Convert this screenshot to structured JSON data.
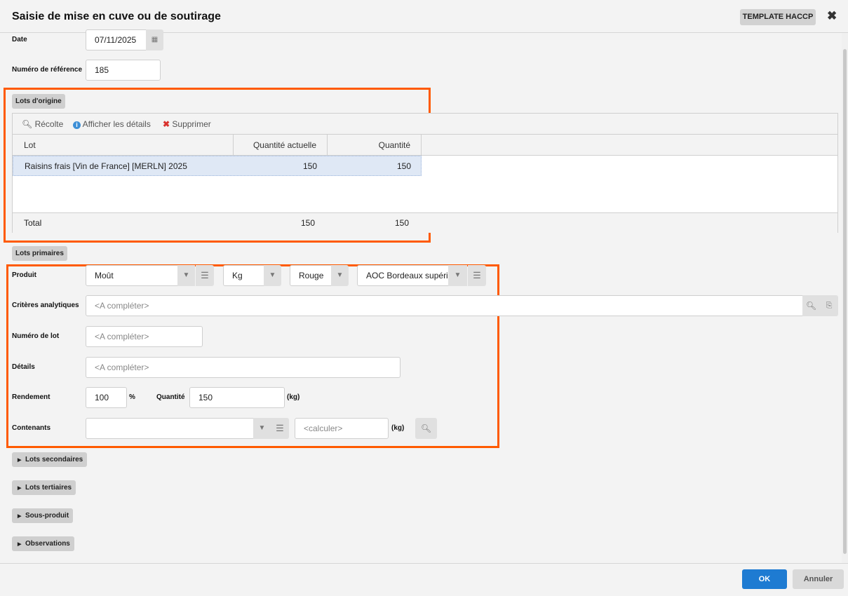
{
  "dialog": {
    "title": "Saisie de mise en cuve ou de soutirage",
    "template_button": "TEMPLATE HACCP",
    "close_icon": "close-icon"
  },
  "date": {
    "label": "Date",
    "value": "07/11/2025"
  },
  "reference": {
    "label": "Numéro de référence",
    "value": "185"
  },
  "lots_origine": {
    "section_label": "Lots d'origine",
    "toolbar": {
      "harvest": "Récolte",
      "details": "Afficher les détails",
      "delete": "Supprimer"
    },
    "columns": [
      "Lot",
      "Quantité actuelle",
      "Quantité"
    ],
    "rows": [
      {
        "lot": "Raisins frais [Vin de France] [MERLN] 2025",
        "current": "150",
        "quantity": "150"
      }
    ],
    "total": {
      "label": "Total",
      "current": "150",
      "quantity": "150"
    }
  },
  "lots_primaires": {
    "section_label": "Lots primaires",
    "produit": {
      "label": "Produit",
      "product": "Moût",
      "unit": "Kg",
      "color": "Rouge",
      "appellation": "AOC Bordeaux supéri"
    },
    "criteres": {
      "label": "Critères analytiques",
      "placeholder": "<A compléter>"
    },
    "numero_lot": {
      "label": "Numéro de lot",
      "placeholder": "<A compléter>"
    },
    "details": {
      "label": "Détails",
      "placeholder": "<A compléter>"
    },
    "rendement": {
      "label": "Rendement",
      "value": "100",
      "unit": "%"
    },
    "quantite": {
      "label": "Quantité",
      "value": "150",
      "unit": "(kg)"
    },
    "contenants": {
      "label": "Contenants",
      "value": "",
      "calc_placeholder": "<calculer>",
      "unit": "(kg)"
    }
  },
  "collapsed_sections": [
    "Lots secondaires",
    "Lots tertiaires",
    "Sous-produit",
    "Observations"
  ],
  "footer": {
    "ok": "OK",
    "cancel": "Annuler"
  },
  "colors": {
    "highlight": "#ff5a00",
    "primary": "#1e7bd2",
    "selected_row": "#dfe8f5"
  }
}
